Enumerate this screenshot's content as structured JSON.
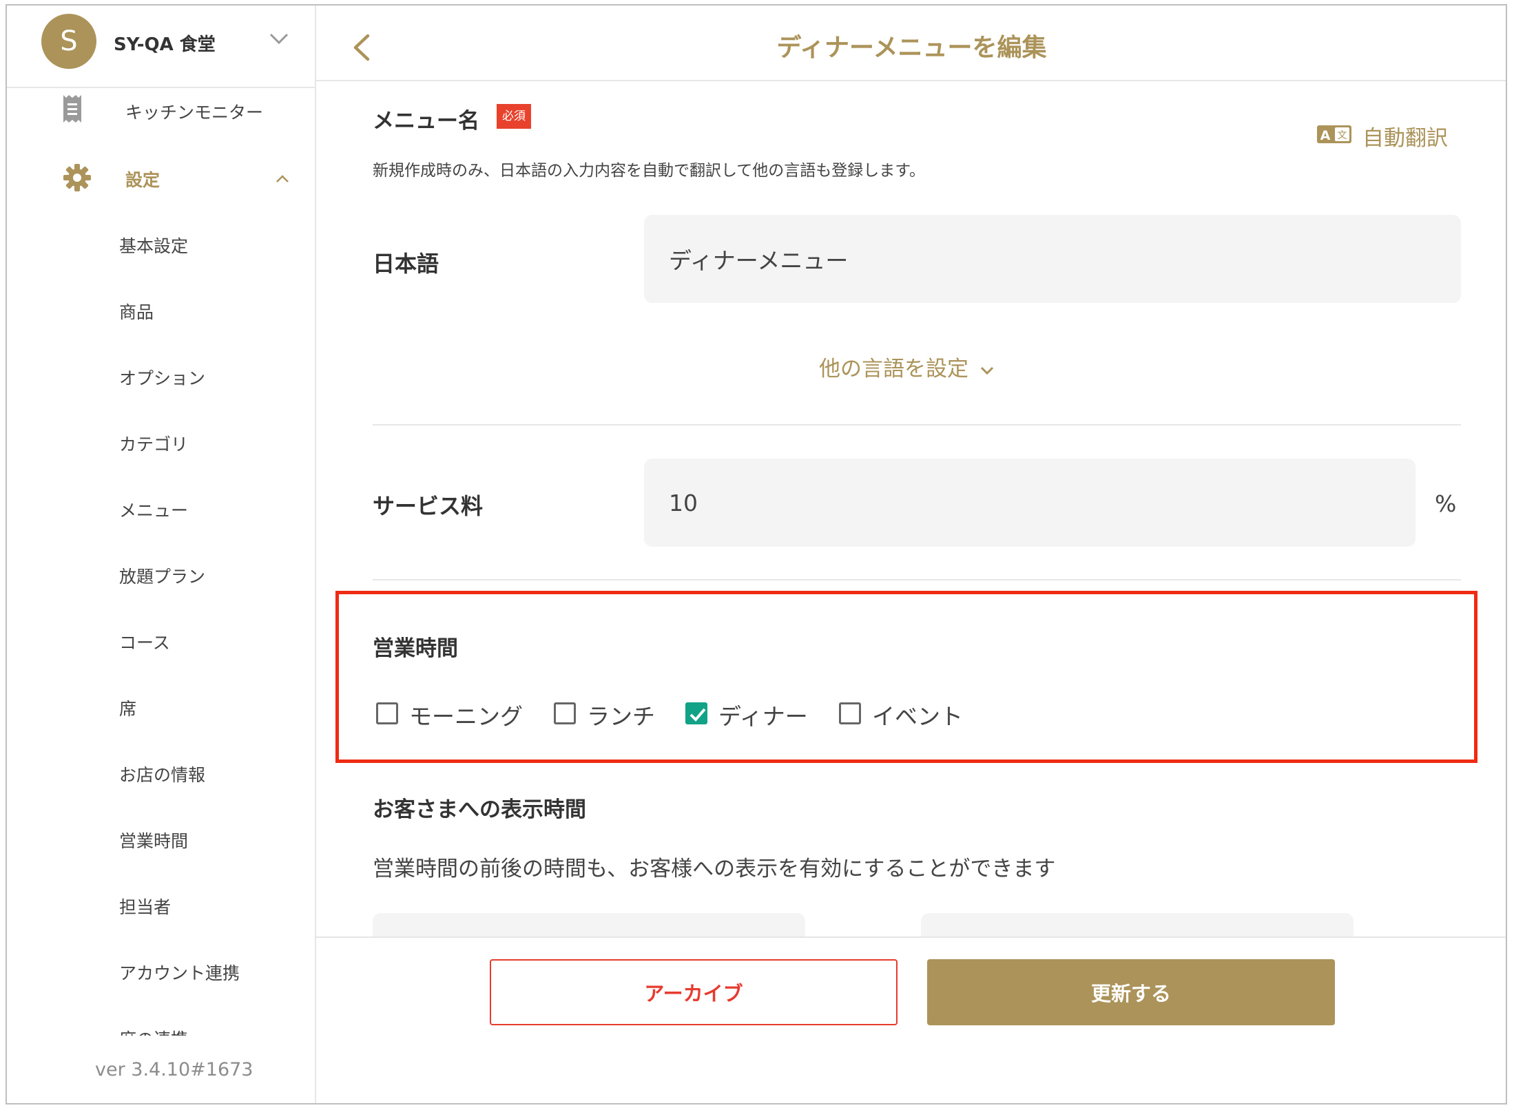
{
  "sidebar": {
    "store_initial": "S",
    "store_name": "SY-QA 食堂",
    "kitchen_monitor": "キッチンモニター",
    "settings": "設定",
    "items": [
      {
        "label": "基本設定"
      },
      {
        "label": "商品"
      },
      {
        "label": "オプション"
      },
      {
        "label": "カテゴリ"
      },
      {
        "label": "メニュー"
      },
      {
        "label": "放題プラン"
      },
      {
        "label": "コース"
      },
      {
        "label": "席"
      },
      {
        "label": "お店の情報"
      },
      {
        "label": "営業時間"
      },
      {
        "label": "担当者"
      },
      {
        "label": "アカウント連携"
      },
      {
        "label": "席の連携"
      }
    ],
    "version": "ver 3.4.10#1673"
  },
  "header": {
    "title": "ディナーメニューを編集"
  },
  "menu_name": {
    "label": "メニュー名",
    "required_badge": "必須",
    "auto_translate": "自動翻訳",
    "help": "新規作成時のみ、日本語の入力内容を自動で翻訳して他の言語も登録します。",
    "japanese_label": "日本語",
    "japanese_value": "ディナーメニュー",
    "other_languages": "他の言語を設定"
  },
  "service_fee": {
    "label": "サービス料",
    "value": "10",
    "unit": "%"
  },
  "business_hours": {
    "label": "営業時間",
    "options": [
      {
        "label": "モーニング",
        "checked": false
      },
      {
        "label": "ランチ",
        "checked": false
      },
      {
        "label": "ディナー",
        "checked": true
      },
      {
        "label": "イベント",
        "checked": false
      }
    ]
  },
  "display_time": {
    "label": "お客さまへの表示時間",
    "description": "営業時間の前後の時間も、お客様への表示を有効にすることができます"
  },
  "footer": {
    "archive_label": "アーカイブ",
    "update_label": "更新する"
  },
  "colors": {
    "accent": "#ab9359",
    "danger": "#e63b2e",
    "highlight": "#ef2b14",
    "check": "#12a288"
  }
}
